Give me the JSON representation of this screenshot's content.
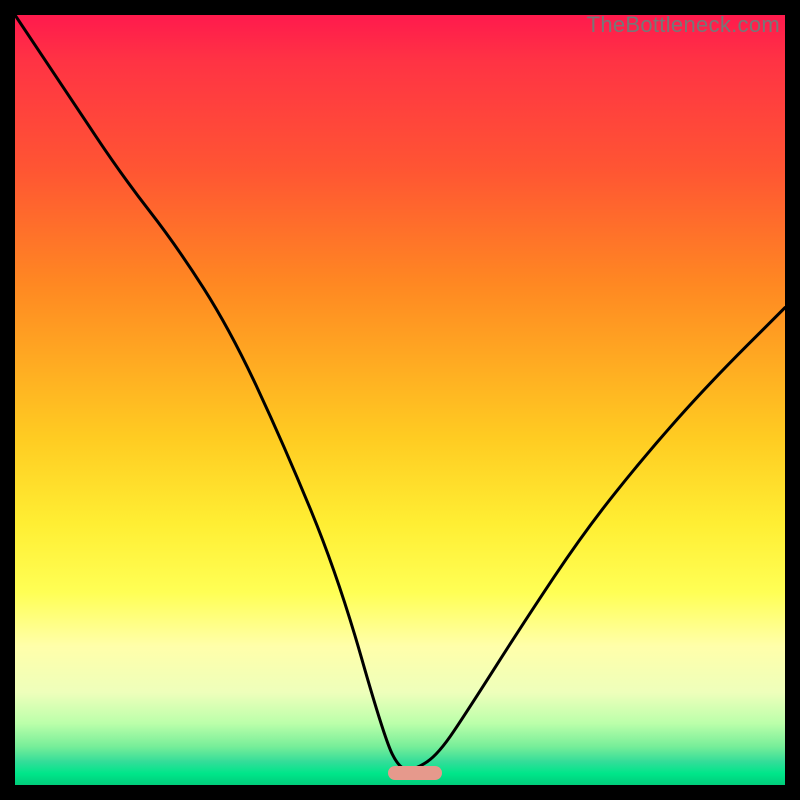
{
  "watermark": "TheBottleneck.com",
  "chart_data": {
    "type": "line",
    "title": "",
    "xlabel": "",
    "ylabel": "",
    "xlim": [
      0,
      1
    ],
    "ylim": [
      0,
      1
    ],
    "grid": false,
    "background": "rainbow-vertical-gradient",
    "series": [
      {
        "name": "bottleneck-curve",
        "x": [
          0.0,
          0.07,
          0.14,
          0.21,
          0.28,
          0.35,
          0.42,
          0.48,
          0.5,
          0.52,
          0.55,
          0.59,
          0.66,
          0.74,
          0.82,
          0.9,
          1.0
        ],
        "y": [
          1.0,
          0.895,
          0.79,
          0.7,
          0.59,
          0.44,
          0.27,
          0.06,
          0.02,
          0.02,
          0.04,
          0.1,
          0.21,
          0.33,
          0.43,
          0.52,
          0.62
        ]
      }
    ],
    "marker": {
      "name": "optimal-range",
      "x_start": 0.485,
      "x_end": 0.555,
      "y": 0.015,
      "color": "#e6998c"
    }
  }
}
